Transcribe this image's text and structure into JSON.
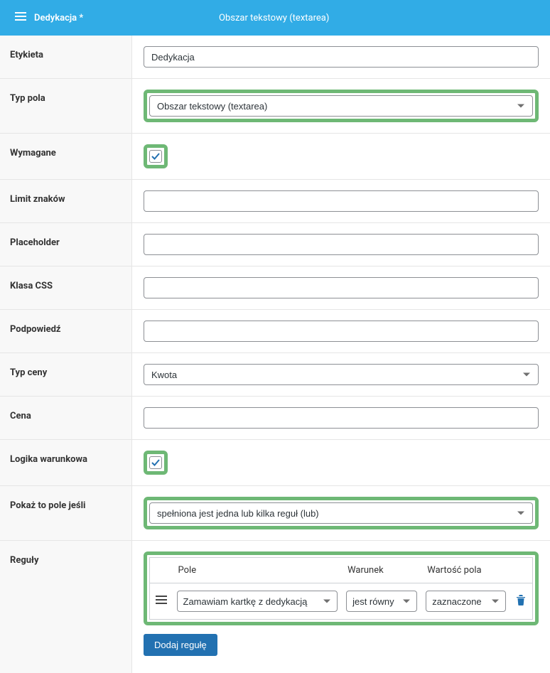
{
  "header": {
    "title": "Dedykacja *",
    "type": "Obszar tekstowy (textarea)"
  },
  "labels": {
    "etykieta": "Etykieta",
    "typ_pola": "Typ pola",
    "wymagane": "Wymagane",
    "limit_znakow": "Limit znaków",
    "placeholder": "Placeholder",
    "klasa_css": "Klasa CSS",
    "podpowiedz": "Podpowiedź",
    "typ_ceny": "Typ ceny",
    "cena": "Cena",
    "logika_warunkowa": "Logika warunkowa",
    "pokaz_to_pole": "Pokaż to pole jeśli",
    "reguly": "Reguły"
  },
  "values": {
    "etykieta": "Dedykacja",
    "typ_pola": "Obszar tekstowy (textarea)",
    "limit_znakow": "",
    "placeholder": "",
    "klasa_css": "",
    "podpowiedz": "",
    "typ_ceny": "Kwota",
    "cena": "",
    "pokaz_to_pole": "spełniona jest jedna lub kilka reguł (lub)"
  },
  "rules_table": {
    "headers": {
      "pole": "Pole",
      "warunek": "Warunek",
      "wartosc": "Wartość pola"
    },
    "row": {
      "pole": "Zamawiam kartkę z dedykacją",
      "warunek": "jest równy",
      "wartosc": "zaznaczone"
    }
  },
  "buttons": {
    "dodaj_regule": "Dodaj regułę"
  }
}
